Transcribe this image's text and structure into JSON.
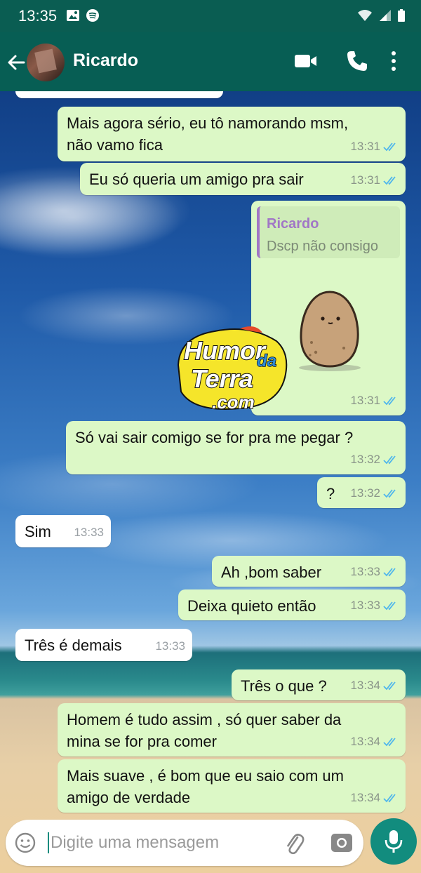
{
  "status_bar": {
    "time": "13:35"
  },
  "header": {
    "contact_name": "Ricardo"
  },
  "messages": [
    {
      "direction": "out",
      "text": "Mais agora sério, eu tô namorando msm,\nnão vamo fica",
      "time": "13:31"
    },
    {
      "direction": "out",
      "text": "Eu só queria um amigo pra sair",
      "time": "13:31"
    },
    {
      "direction": "out",
      "type": "quoted-sticker",
      "quote_author": "Ricardo",
      "quote_text": "Dscp não consigo",
      "time": "13:31"
    },
    {
      "direction": "out",
      "text": "Só vai sair comigo se for pra me pegar ?",
      "time": "13:32"
    },
    {
      "direction": "out",
      "text": "?",
      "time": "13:32"
    },
    {
      "direction": "in",
      "text": "Sim",
      "time": "13:33"
    },
    {
      "direction": "out",
      "text": "Ah ,bom saber",
      "time": "13:33"
    },
    {
      "direction": "out",
      "text": "Deixa quieto então",
      "time": "13:33"
    },
    {
      "direction": "in",
      "text": "Três é demais",
      "time": "13:33"
    },
    {
      "direction": "out",
      "text": "Três o que ?",
      "time": "13:34"
    },
    {
      "direction": "out",
      "text": "Homem é tudo assim , só quer saber da\nmina se for pra comer",
      "time": "13:34"
    },
    {
      "direction": "out",
      "text": "Mais suave , é bom que eu saio com um\namigo de verdade",
      "time": "13:34"
    }
  ],
  "watermark": {
    "line1": "Humor",
    "line2": "da",
    "line3": "Terra",
    "line4": ".com"
  },
  "input": {
    "placeholder": "Digite uma mensagem"
  },
  "colors": {
    "header": "#075e54",
    "status_bar": "#0a5d52",
    "outgoing_bubble": "#dcf8c6",
    "incoming_bubble": "#ffffff",
    "read_ticks": "#4fb6ec",
    "fab": "#128c7e"
  }
}
